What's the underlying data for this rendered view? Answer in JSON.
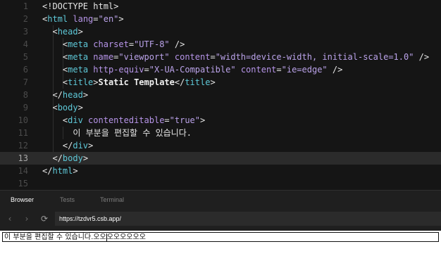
{
  "editor": {
    "active_line": "13",
    "lines": [
      {
        "n": "1",
        "indent": "",
        "parts": [
          [
            "p",
            "<!DOCTYPE html>"
          ]
        ]
      },
      {
        "n": "2",
        "indent": "",
        "parts": [
          [
            "p",
            "<"
          ],
          [
            "t",
            "html"
          ],
          [
            "a",
            " lang"
          ],
          [
            "p",
            "="
          ],
          [
            "s",
            "\"en\""
          ],
          [
            "p",
            ">"
          ]
        ]
      },
      {
        "n": "3",
        "indent": "  ",
        "parts": [
          [
            "p",
            "<"
          ],
          [
            "t",
            "head"
          ],
          [
            "p",
            ">"
          ]
        ]
      },
      {
        "n": "4",
        "indent": "    ",
        "parts": [
          [
            "p",
            "<"
          ],
          [
            "t",
            "meta"
          ],
          [
            "a",
            " charset"
          ],
          [
            "p",
            "="
          ],
          [
            "s",
            "\"UTF-8\""
          ],
          [
            "p",
            " />"
          ]
        ]
      },
      {
        "n": "5",
        "indent": "    ",
        "parts": [
          [
            "p",
            "<"
          ],
          [
            "t",
            "meta"
          ],
          [
            "a",
            " name"
          ],
          [
            "p",
            "="
          ],
          [
            "s",
            "\"viewport\""
          ],
          [
            "a",
            " content"
          ],
          [
            "p",
            "="
          ],
          [
            "s",
            "\"width=device-width, initial-scale=1.0\""
          ],
          [
            "p",
            " />"
          ]
        ]
      },
      {
        "n": "6",
        "indent": "    ",
        "parts": [
          [
            "p",
            "<"
          ],
          [
            "t",
            "meta"
          ],
          [
            "a",
            " http-equiv"
          ],
          [
            "p",
            "="
          ],
          [
            "s",
            "\"X-UA-Compatible\""
          ],
          [
            "a",
            " content"
          ],
          [
            "p",
            "="
          ],
          [
            "s",
            "\"ie=edge\""
          ],
          [
            "p",
            " />"
          ]
        ]
      },
      {
        "n": "7",
        "indent": "    ",
        "parts": [
          [
            "p",
            "<"
          ],
          [
            "t",
            "title"
          ],
          [
            "p",
            ">"
          ],
          [
            "b",
            "Static Template"
          ],
          [
            "p",
            "</"
          ],
          [
            "t",
            "title"
          ],
          [
            "p",
            ">"
          ]
        ]
      },
      {
        "n": "8",
        "indent": "  ",
        "parts": [
          [
            "p",
            "</"
          ],
          [
            "t",
            "head"
          ],
          [
            "p",
            ">"
          ]
        ]
      },
      {
        "n": "9",
        "indent": "  ",
        "parts": [
          [
            "p",
            "<"
          ],
          [
            "t",
            "body"
          ],
          [
            "p",
            ">"
          ]
        ]
      },
      {
        "n": "10",
        "indent": "    ",
        "parts": [
          [
            "p",
            "<"
          ],
          [
            "t",
            "div"
          ],
          [
            "a",
            " contenteditable"
          ],
          [
            "p",
            "="
          ],
          [
            "s",
            "\"true\""
          ],
          [
            "p",
            ">"
          ]
        ]
      },
      {
        "n": "11",
        "indent": "      ",
        "parts": [
          [
            "p",
            "이 부분을 편집할 수 있습니다."
          ]
        ]
      },
      {
        "n": "12",
        "indent": "    ",
        "parts": [
          [
            "p",
            "</"
          ],
          [
            "t",
            "div"
          ],
          [
            "p",
            ">"
          ]
        ]
      },
      {
        "n": "13",
        "indent": "  ",
        "parts": [
          [
            "p",
            "</"
          ],
          [
            "t",
            "body"
          ],
          [
            "p",
            ">"
          ]
        ]
      },
      {
        "n": "14",
        "indent": "",
        "parts": [
          [
            "p",
            "</"
          ],
          [
            "t",
            "html"
          ],
          [
            "p",
            ">"
          ]
        ]
      },
      {
        "n": "15",
        "indent": "",
        "parts": []
      }
    ]
  },
  "panel": {
    "tabs": [
      {
        "label": "Browser",
        "active": true
      },
      {
        "label": "Tests",
        "active": false
      },
      {
        "label": "Terminal",
        "active": false
      }
    ],
    "nav": {
      "back_icon": "chevron-left-icon",
      "forward_icon": "chevron-right-icon",
      "refresh_icon": "refresh-icon",
      "url": "https://tzdvr5.csb.app/"
    },
    "preview": {
      "before_caret": "이 부분을 편집할 수 있습니다.오오",
      "after_caret": "오오오오오오"
    }
  },
  "colors": {
    "editor_bg": "#151515",
    "tag": "#5ec8d8",
    "attr": "#b694e8",
    "string": "#bba3ea",
    "panel_bg": "#1f1f1f"
  }
}
